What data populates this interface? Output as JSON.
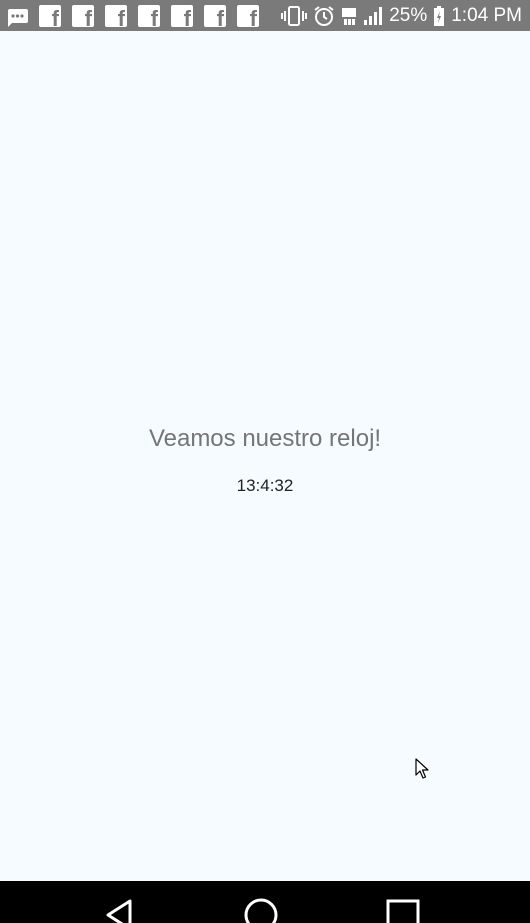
{
  "status_bar": {
    "notification_icons": [
      "messaging-icon",
      "facebook-icon",
      "facebook-icon",
      "facebook-icon",
      "facebook-icon",
      "facebook-icon",
      "facebook-icon",
      "facebook-icon"
    ],
    "facebook_glyph": "f",
    "system_icons": [
      "vibrate-icon",
      "alarm-icon",
      "4g-icon",
      "signal-icon"
    ],
    "battery": "25%",
    "time": "1:04 PM"
  },
  "main": {
    "title": "Veamos nuestro reloj!",
    "clock": "13:4:32"
  },
  "nav_bar": {
    "buttons": [
      "back-icon",
      "home-icon",
      "recents-icon"
    ]
  },
  "colors": {
    "status_bar_bg": "#7a7a7a",
    "background": "#f6fbff",
    "title_text": "#757575",
    "clock_text": "#222222",
    "nav_bar_bg": "#000000"
  }
}
